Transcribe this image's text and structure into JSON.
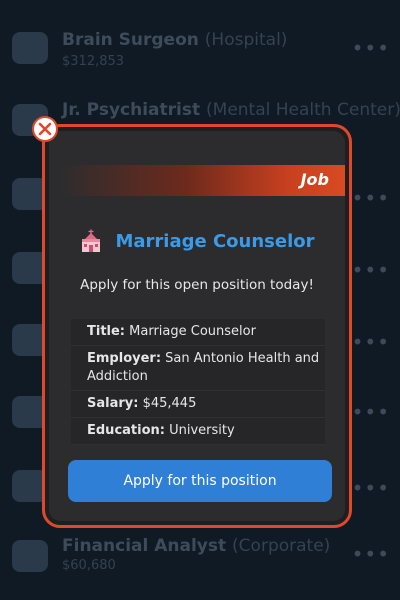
{
  "background_list": [
    {
      "title": "Brain Surgeon",
      "subtitle": "(Hospital)",
      "salary": "$312,853"
    },
    {
      "title": "Jr. Psychiatrist",
      "subtitle": "(Mental Health Center)",
      "salary": ""
    },
    {
      "title": "Financial Analyst",
      "subtitle": "(Corporate)",
      "salary": "$60,680"
    }
  ],
  "more_glyph": "•••",
  "modal": {
    "banner_label": "Job",
    "heading": "Marriage Counselor",
    "subtitle": "Apply for this open position today!",
    "details": [
      {
        "key": "Title:",
        "value": "Marriage Counselor"
      },
      {
        "key": "Employer:",
        "value": "San Antonio Health and Addiction"
      },
      {
        "key": "Salary:",
        "value": "$45,445"
      },
      {
        "key": "Education:",
        "value": "University"
      }
    ],
    "apply_button": "Apply for this position"
  },
  "colors": {
    "accent_red": "#e0482c",
    "heading_blue": "#3b9be8",
    "button_blue": "#2f7fd6"
  }
}
